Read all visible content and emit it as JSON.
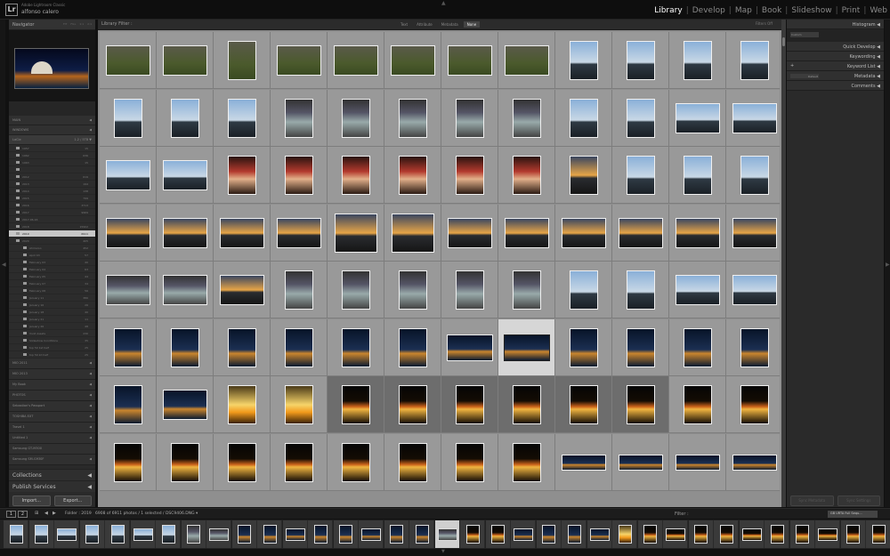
{
  "app": {
    "product": "Adobe Lightroom Classic",
    "user": "alfonso calero",
    "logo": "Lr"
  },
  "modules": [
    "Library",
    "Develop",
    "Map",
    "Book",
    "Slideshow",
    "Print",
    "Web"
  ],
  "left": {
    "navigator": "Navigator",
    "zooms": [
      "FIT",
      "FILL",
      "1:1",
      "2:1"
    ],
    "collapsed": [
      {
        "label": "MAIN",
        "arrow": "◀"
      },
      {
        "label": "WINDOWS",
        "arrow": "◀"
      }
    ],
    "lacie": {
      "label": "LaCie",
      "info": "1.2 / 5TB",
      "arrow": "▼"
    },
    "folders": [
      {
        "label": "1957",
        "count": "15"
      },
      {
        "label": "1962",
        "count": "636"
      },
      {
        "label": "1963",
        "count": "15"
      },
      {
        "label": "",
        "count": ""
      },
      {
        "label": "2012",
        "count": "619"
      },
      {
        "label": "2013",
        "count": "194"
      },
      {
        "label": "2014",
        "count": "138"
      },
      {
        "label": "2015",
        "count": "799"
      },
      {
        "label": "2016",
        "count": "3713"
      },
      {
        "label": "2017",
        "count": "9969"
      },
      {
        "label": "2017-06-16",
        "count": ""
      },
      {
        "label": "2018",
        "count": "15902"
      },
      {
        "label": "2019",
        "count": "6911",
        "selected": true
      },
      {
        "label": "2020",
        "count": "405"
      }
    ],
    "subfolders": [
      {
        "label": "Ahmaroo",
        "count": "452"
      },
      {
        "label": "April 03",
        "count": "57"
      },
      {
        "label": "February 03",
        "count": "40"
      },
      {
        "label": "February 04",
        "count": "63"
      },
      {
        "label": "February 05",
        "count": "44"
      },
      {
        "label": "February 07",
        "count": "34"
      },
      {
        "label": "February 08",
        "count": "56"
      },
      {
        "label": "January 11",
        "count": "380"
      },
      {
        "label": "January 16",
        "count": "26"
      },
      {
        "label": "January 18",
        "count": "40"
      },
      {
        "label": "January 21",
        "count": "11"
      },
      {
        "label": "January 26",
        "count": "48"
      },
      {
        "label": "Vivid Assets",
        "count": "230"
      },
      {
        "label": "Slideshow Conditions",
        "count": "35"
      },
      {
        "label": "top 50 1st half",
        "count": "25"
      },
      {
        "label": "top 50 2d half",
        "count": "25"
      }
    ],
    "devices": [
      {
        "label": "MIO 2011",
        "arrow": "◀"
      },
      {
        "label": "MIO 2013",
        "arrow": "◀"
      },
      {
        "label": "My Book",
        "arrow": "◀"
      },
      {
        "label": "PHOTOS",
        "arrow": "◀"
      },
      {
        "label": "Sebastian's Passport",
        "arrow": "◀"
      },
      {
        "label": "TOSHIBA EXT",
        "arrow": "◀"
      },
      {
        "label": "Travel 1",
        "arrow": "◀"
      },
      {
        "label": "Untitled 1",
        "arrow": "◀"
      },
      {
        "label": "Samsung GT-I9300",
        "arrow": ""
      },
      {
        "label": "Samsung SM-G930F",
        "arrow": "◀"
      }
    ],
    "collections": "Collections",
    "publish": "Publish Services",
    "import": "Import...",
    "export": "Export..."
  },
  "center": {
    "filter_title": "Library Filter :",
    "filter_tabs": [
      "Text",
      "Attribute",
      "Metadata",
      "None"
    ],
    "filter_active": "None",
    "filter_right": "Filters Off"
  },
  "right": {
    "panels": [
      "Histogram",
      "Quick Develop",
      "Keywording",
      "Keyword List",
      "Metadata",
      "Comments"
    ],
    "saved_preset": "Custom",
    "metadata_preset": "Default",
    "sync_meta": "Sync Metadata",
    "sync_settings": "Sync Settings"
  },
  "filmstrip": {
    "pages": [
      "1",
      "2"
    ],
    "path": "Folder : 2019",
    "count_text": "6908 of 6911 photos / 1 selected / DSC9406.DNG ▾",
    "filter_label": "Filter :",
    "preset": "GB URTA Full Sequ..."
  },
  "icons": [
    "grid-icon",
    "back-arrow-icon",
    "forward-arrow-icon",
    "triangle-icon",
    "folder-icon"
  ]
}
